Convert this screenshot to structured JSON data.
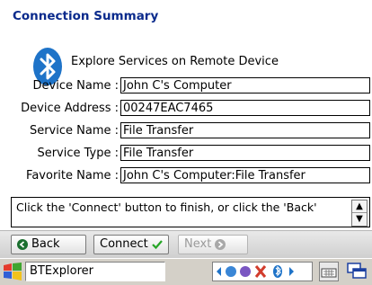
{
  "title": "Connection Summary",
  "subtitle": "Explore Services on Remote Device",
  "fields": [
    {
      "label": "Device Name :",
      "value": "John C's Computer"
    },
    {
      "label": "Device Address :",
      "value": "00247EAC7465"
    },
    {
      "label": "Service Name :",
      "value": "File Transfer"
    },
    {
      "label": "Service Type :",
      "value": "File Transfer"
    },
    {
      "label": "Favorite Name :",
      "value": "John C's Computer:File Transfer"
    }
  ],
  "message": "Click the 'Connect' button to finish, or click the 'Back'",
  "buttons": {
    "back": "Back",
    "connect": "Connect",
    "next": "Next"
  },
  "taskbar": {
    "app_name": "BTExplorer"
  },
  "icons": {
    "bluetooth": "bluetooth-logo",
    "start": "windows-flag-icon",
    "keyboard": "keyboard-icon",
    "windows": "window-switch-icon"
  },
  "colors": {
    "title": "#0a2a8c",
    "bluetooth": "#1e73c8",
    "connect_check": "#25a525",
    "back_arrow": "#1b6f2f"
  }
}
